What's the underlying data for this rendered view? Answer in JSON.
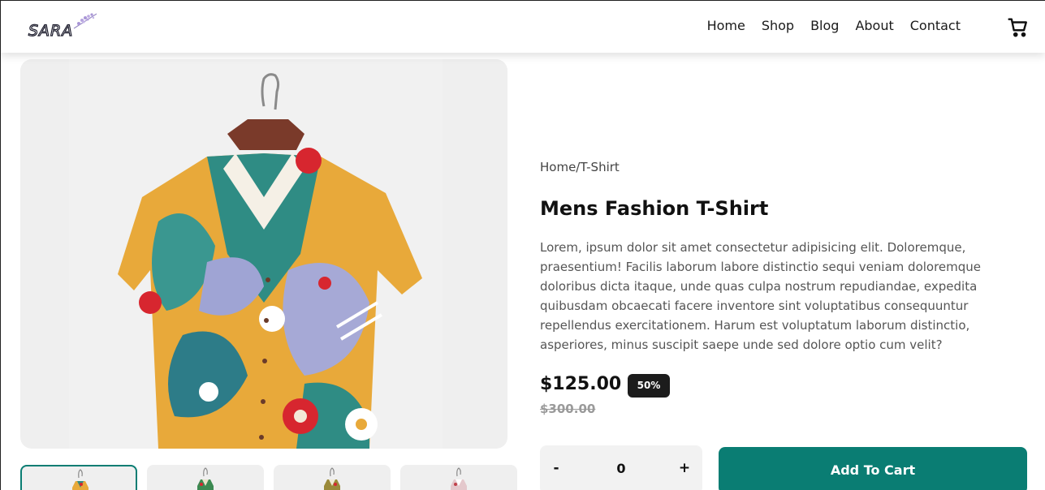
{
  "brand": {
    "name": "SARA"
  },
  "nav": {
    "links": [
      "Home",
      "Shop",
      "Blog",
      "About",
      "Contact"
    ],
    "cart_icon": "cart-icon"
  },
  "product": {
    "breadcrumb": "Home/T-Shirt",
    "title": "Mens Fashion T-Shirt",
    "description": "Lorem, ipsum dolor sit amet consectetur adipisicing elit. Doloremque, praesentium! Facilis laborum labore distinctio sequi veniam doloremque doloribus dicta itaque, unde quas culpa nostrum repudiandae, expedita quibusdam obcaecati facere inventore sint voluptatibus consequuntur repellendus exercitationem. Harum est voluptatum laborum distinctio, asperiores, minus suscipit saepe unde sed dolore optio cum velit?",
    "price": "$125.00",
    "discount_badge": "50%",
    "old_price": "$300.00"
  },
  "quantity": {
    "minus_label": "-",
    "value": "0",
    "plus_label": "+"
  },
  "add_to_cart_label": "Add To Cart",
  "colors": {
    "accent": "#0a7d73",
    "badge_bg": "#1c1c1c",
    "image_bg": "#efefef"
  }
}
